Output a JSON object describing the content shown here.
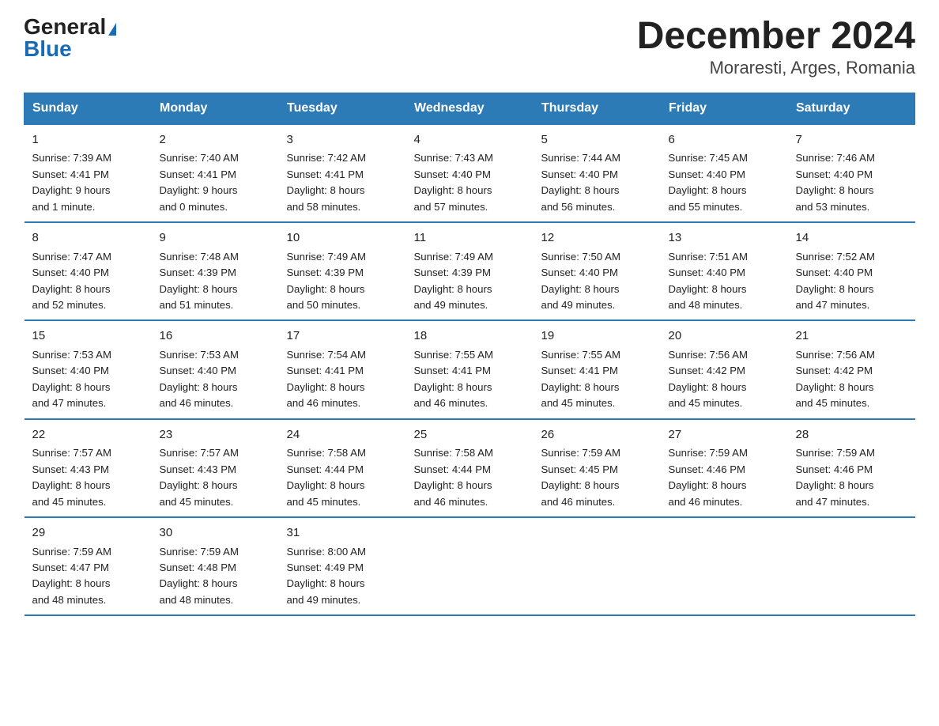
{
  "header": {
    "logo_general": "General",
    "logo_blue": "Blue",
    "title": "December 2024",
    "subtitle": "Moraresti, Arges, Romania"
  },
  "days_of_week": [
    "Sunday",
    "Monday",
    "Tuesday",
    "Wednesday",
    "Thursday",
    "Friday",
    "Saturday"
  ],
  "weeks": [
    [
      {
        "day": "1",
        "info": "Sunrise: 7:39 AM\nSunset: 4:41 PM\nDaylight: 9 hours\nand 1 minute."
      },
      {
        "day": "2",
        "info": "Sunrise: 7:40 AM\nSunset: 4:41 PM\nDaylight: 9 hours\nand 0 minutes."
      },
      {
        "day": "3",
        "info": "Sunrise: 7:42 AM\nSunset: 4:41 PM\nDaylight: 8 hours\nand 58 minutes."
      },
      {
        "day": "4",
        "info": "Sunrise: 7:43 AM\nSunset: 4:40 PM\nDaylight: 8 hours\nand 57 minutes."
      },
      {
        "day": "5",
        "info": "Sunrise: 7:44 AM\nSunset: 4:40 PM\nDaylight: 8 hours\nand 56 minutes."
      },
      {
        "day": "6",
        "info": "Sunrise: 7:45 AM\nSunset: 4:40 PM\nDaylight: 8 hours\nand 55 minutes."
      },
      {
        "day": "7",
        "info": "Sunrise: 7:46 AM\nSunset: 4:40 PM\nDaylight: 8 hours\nand 53 minutes."
      }
    ],
    [
      {
        "day": "8",
        "info": "Sunrise: 7:47 AM\nSunset: 4:40 PM\nDaylight: 8 hours\nand 52 minutes."
      },
      {
        "day": "9",
        "info": "Sunrise: 7:48 AM\nSunset: 4:39 PM\nDaylight: 8 hours\nand 51 minutes."
      },
      {
        "day": "10",
        "info": "Sunrise: 7:49 AM\nSunset: 4:39 PM\nDaylight: 8 hours\nand 50 minutes."
      },
      {
        "day": "11",
        "info": "Sunrise: 7:49 AM\nSunset: 4:39 PM\nDaylight: 8 hours\nand 49 minutes."
      },
      {
        "day": "12",
        "info": "Sunrise: 7:50 AM\nSunset: 4:40 PM\nDaylight: 8 hours\nand 49 minutes."
      },
      {
        "day": "13",
        "info": "Sunrise: 7:51 AM\nSunset: 4:40 PM\nDaylight: 8 hours\nand 48 minutes."
      },
      {
        "day": "14",
        "info": "Sunrise: 7:52 AM\nSunset: 4:40 PM\nDaylight: 8 hours\nand 47 minutes."
      }
    ],
    [
      {
        "day": "15",
        "info": "Sunrise: 7:53 AM\nSunset: 4:40 PM\nDaylight: 8 hours\nand 47 minutes."
      },
      {
        "day": "16",
        "info": "Sunrise: 7:53 AM\nSunset: 4:40 PM\nDaylight: 8 hours\nand 46 minutes."
      },
      {
        "day": "17",
        "info": "Sunrise: 7:54 AM\nSunset: 4:41 PM\nDaylight: 8 hours\nand 46 minutes."
      },
      {
        "day": "18",
        "info": "Sunrise: 7:55 AM\nSunset: 4:41 PM\nDaylight: 8 hours\nand 46 minutes."
      },
      {
        "day": "19",
        "info": "Sunrise: 7:55 AM\nSunset: 4:41 PM\nDaylight: 8 hours\nand 45 minutes."
      },
      {
        "day": "20",
        "info": "Sunrise: 7:56 AM\nSunset: 4:42 PM\nDaylight: 8 hours\nand 45 minutes."
      },
      {
        "day": "21",
        "info": "Sunrise: 7:56 AM\nSunset: 4:42 PM\nDaylight: 8 hours\nand 45 minutes."
      }
    ],
    [
      {
        "day": "22",
        "info": "Sunrise: 7:57 AM\nSunset: 4:43 PM\nDaylight: 8 hours\nand 45 minutes."
      },
      {
        "day": "23",
        "info": "Sunrise: 7:57 AM\nSunset: 4:43 PM\nDaylight: 8 hours\nand 45 minutes."
      },
      {
        "day": "24",
        "info": "Sunrise: 7:58 AM\nSunset: 4:44 PM\nDaylight: 8 hours\nand 45 minutes."
      },
      {
        "day": "25",
        "info": "Sunrise: 7:58 AM\nSunset: 4:44 PM\nDaylight: 8 hours\nand 46 minutes."
      },
      {
        "day": "26",
        "info": "Sunrise: 7:59 AM\nSunset: 4:45 PM\nDaylight: 8 hours\nand 46 minutes."
      },
      {
        "day": "27",
        "info": "Sunrise: 7:59 AM\nSunset: 4:46 PM\nDaylight: 8 hours\nand 46 minutes."
      },
      {
        "day": "28",
        "info": "Sunrise: 7:59 AM\nSunset: 4:46 PM\nDaylight: 8 hours\nand 47 minutes."
      }
    ],
    [
      {
        "day": "29",
        "info": "Sunrise: 7:59 AM\nSunset: 4:47 PM\nDaylight: 8 hours\nand 48 minutes."
      },
      {
        "day": "30",
        "info": "Sunrise: 7:59 AM\nSunset: 4:48 PM\nDaylight: 8 hours\nand 48 minutes."
      },
      {
        "day": "31",
        "info": "Sunrise: 8:00 AM\nSunset: 4:49 PM\nDaylight: 8 hours\nand 49 minutes."
      },
      {
        "day": "",
        "info": ""
      },
      {
        "day": "",
        "info": ""
      },
      {
        "day": "",
        "info": ""
      },
      {
        "day": "",
        "info": ""
      }
    ]
  ]
}
